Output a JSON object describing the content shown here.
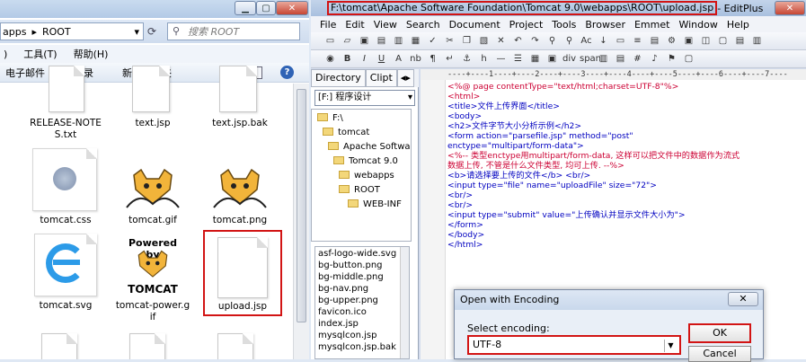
{
  "explorer": {
    "breadcrumb_prefix": "apps",
    "breadcrumb_current": "ROOT",
    "search_placeholder": "搜索 ROOT",
    "menu": [
      ")",
      "工具(T)",
      "帮助(H)"
    ],
    "commands": [
      "电子邮件",
      "刻录",
      "新建文件夹"
    ],
    "files": [
      {
        "name": "RELEASE-NOTES.txt",
        "line1": "RELEASE-NOTE",
        "line2": "S.txt",
        "icon": "document-icon"
      },
      {
        "name": "text.jsp",
        "line1": "text.jsp",
        "line2": "",
        "icon": "document-icon"
      },
      {
        "name": "text.jsp.bak",
        "line1": "text.jsp.bak",
        "line2": "",
        "icon": "document-icon"
      },
      {
        "name": "tomcat.css",
        "line1": "tomcat.css",
        "line2": "",
        "icon": "css-file-icon"
      },
      {
        "name": "tomcat.gif",
        "line1": "tomcat.gif",
        "line2": "",
        "icon": "tomcat-image-icon"
      },
      {
        "name": "tomcat.png",
        "line1": "tomcat.png",
        "line2": "",
        "icon": "tomcat-image-icon"
      },
      {
        "name": "tomcat.svg",
        "line1": "tomcat.svg",
        "line2": "",
        "icon": "ie-icon"
      },
      {
        "name": "tomcat-power.gif",
        "line1": "tomcat-power.g",
        "line2": "if",
        "icon": "tomcat-power-icon"
      },
      {
        "name": "upload.jsp",
        "line1": "upload.jsp",
        "line2": "",
        "icon": "document-icon",
        "selected": true
      }
    ],
    "powered_by_text": "Powered by",
    "tomcat_text": "TOMCAT"
  },
  "editplus": {
    "title_path": "F:\\tomcat\\Apache Software Foundation\\Tomcat 9.0\\webapps\\ROOT\\upload.jsp",
    "title_suffix": " - EditPlus",
    "menu": [
      "File",
      "Edit",
      "View",
      "Search",
      "Document",
      "Project",
      "Tools",
      "Browser",
      "Emmet",
      "Window",
      "Help"
    ],
    "directory_tabs": [
      "Directory",
      "Clipt"
    ],
    "drive": "[F:] 程序设计",
    "tree": [
      "F:\\",
      "tomcat",
      "Apache Software",
      "Tomcat 9.0",
      "webapps",
      "ROOT",
      "WEB-INF"
    ],
    "file_list": [
      "asf-logo-wide.svg",
      "bg-button.png",
      "bg-middle.png",
      "bg-nav.png",
      "bg-upper.png",
      "favicon.ico",
      "index.jsp",
      "mysqlcon.jsp",
      "mysqlcon.jsp.bak"
    ],
    "ruler": "----+----1----+----2----+----3----+----4----+----5----+----6----+----7----",
    "code": [
      "<%@ page contentType=\"text/html;charset=UTF-8\"%>",
      "<html>",
      "<title>文件上传界面</title>",
      "<body>",
      "<h2>文件字节大小分析示例</h2>",
      "<form action=\"parsefile.jsp\" method=\"post\"",
      "enctype=\"multipart/form-data\">",
      "<%-- 类型enctype用multipart/form-data, 这样可以把文件中的数据作为流式",
      "数据上传, 不管是什么文件类型, 均可上传. --%>",
      "<b>请选择要上传的文件</b> <br/>",
      "<input type=\"file\" name=\"uploadFile\" size=\"72\">",
      "<br/>",
      "<br/>",
      "<input type=\"submit\" value=\"上传确认并显示文件大小为\">",
      "</form>",
      "</body>",
      "</html>"
    ]
  },
  "dialog": {
    "title": "Open with Encoding",
    "label": "Select encoding:",
    "value": "UTF-8",
    "ok": "OK",
    "cancel": "Cancel"
  }
}
